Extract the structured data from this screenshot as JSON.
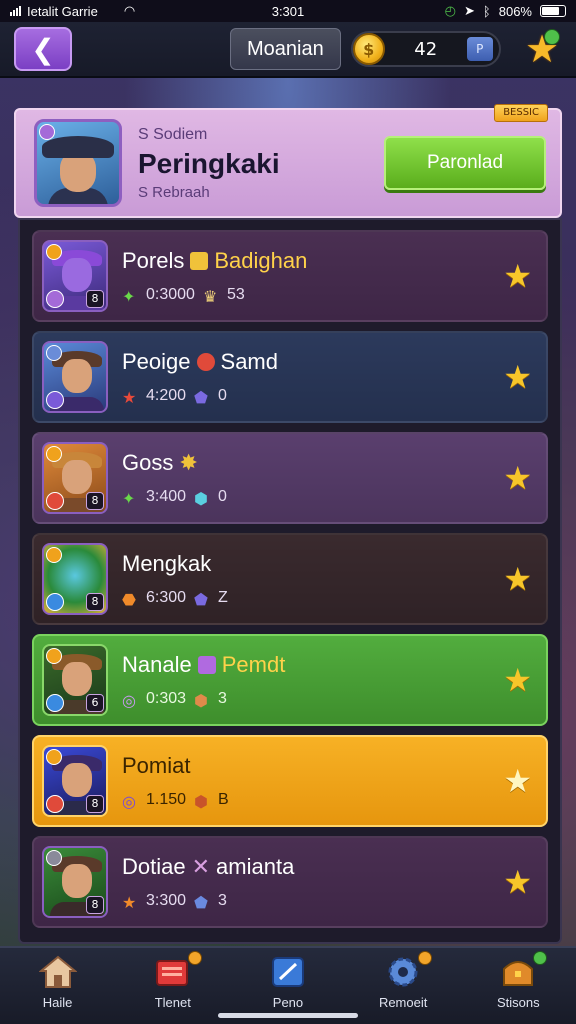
{
  "status_bar": {
    "carrier": "Ietalit Garrie",
    "time": "3:301",
    "battery": "806%"
  },
  "top_bar": {
    "back_icon": "chevron-left-icon",
    "mode_label": "Moanian",
    "coins": "42",
    "plus_label": "P"
  },
  "profile": {
    "tag": "BESSIC",
    "subtitle": "S Sodiem",
    "name": "Peringkaki",
    "detail": "S Rebraah",
    "button_label": "Paronlad"
  },
  "rows": [
    {
      "title": "Porels",
      "highlight": "Badighan",
      "stat1": "0:3000",
      "stat2": "53"
    },
    {
      "title": "Peoige",
      "highlight": "Samd",
      "stat1": "4:200",
      "stat2": "0"
    },
    {
      "title": "Goss",
      "highlight": "",
      "stat1": "3:400",
      "stat2": "0"
    },
    {
      "title": "Mengkak",
      "highlight": "",
      "stat1": "6:300",
      "stat2": "Z"
    },
    {
      "title": "Nanale",
      "highlight": "Pemdt",
      "stat1": "0:303",
      "stat2": "3"
    },
    {
      "title": "Pomiat",
      "highlight": "",
      "stat1": "1.150",
      "stat2": "B"
    },
    {
      "title": "Dotiae",
      "highlight": "amianta",
      "stat1": "3:300",
      "stat2": "3"
    }
  ],
  "nav": [
    {
      "label": "Haile",
      "icon": "home-icon"
    },
    {
      "label": "Tlenet",
      "icon": "cards-icon"
    },
    {
      "label": "Peno",
      "icon": "edit-icon"
    },
    {
      "label": "Remoeit",
      "icon": "gear-icon"
    },
    {
      "label": "Stisons",
      "icon": "chest-icon"
    }
  ],
  "colors": {
    "accent": "#7b3fc4",
    "primary_button": "#5aad1c",
    "highlight_row_green": "#52ad3e",
    "highlight_row_gold": "#f7b125",
    "star": "#f7c62a"
  }
}
